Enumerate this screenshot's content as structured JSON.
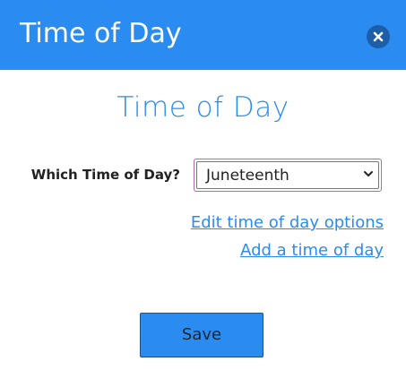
{
  "header": {
    "title": "Time of Day",
    "close_icon": "close-icon"
  },
  "dialog": {
    "title": "Time of Day",
    "field_label": "Which Time of Day?",
    "select": {
      "value": "Juneteenth",
      "chevron_icon": "chevron-down-icon"
    },
    "links": {
      "edit": "Edit time of day options",
      "add": "Add a time of day"
    },
    "save_label": "Save"
  },
  "colors": {
    "header_bg": "#2a8cf0",
    "accent": "#2a8cf0",
    "close_bg": "#1c5fa8",
    "select_focus_border": "#b06aa8"
  }
}
